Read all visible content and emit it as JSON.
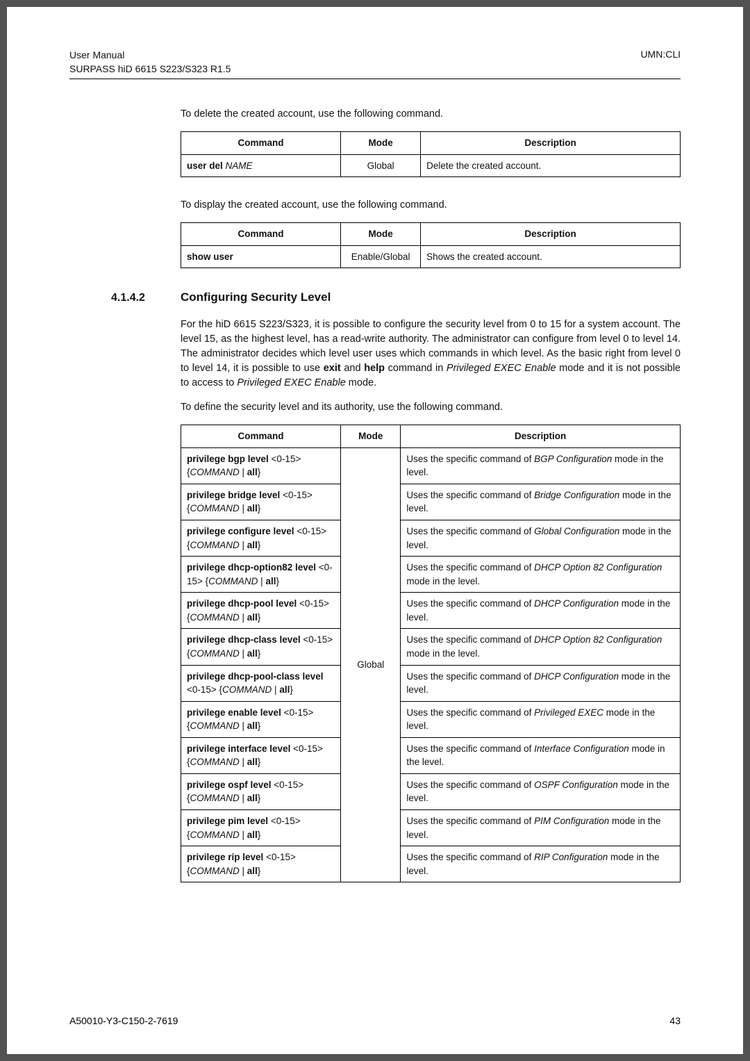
{
  "header": {
    "left1": "User Manual",
    "left2": "SURPASS hiD 6615 S223/S323 R1.5",
    "right": "UMN:CLI"
  },
  "intro1": "To delete the created account, use the following command.",
  "table1": {
    "h1": "Command",
    "h2": "Mode",
    "h3": "Description",
    "r1c1a": "user del ",
    "r1c1b": "NAME",
    "r1c2": "Global",
    "r1c3": "Delete the created account."
  },
  "intro2": "To display the created account, use the following command.",
  "table2": {
    "h1": "Command",
    "h2": "Mode",
    "h3": "Description",
    "r1c1": "show user",
    "r1c2": "Enable/Global",
    "r1c3": "Shows the created account."
  },
  "section": {
    "num": "4.1.4.2",
    "title": "Configuring Security Level"
  },
  "para1a": "For the hiD 6615 S223/S323, it is possible to configure the security level from 0 to 15 for a system account. The level 15, as the highest level, has a read-write authority. The administrator can configure from level 0 to level 14. The administrator decides which level user uses which commands in which level. As the basic right from level 0 to level 14, it is possible to use ",
  "para1b": "exit",
  "para1c": " and ",
  "para1d": "help",
  "para1e": " command in ",
  "para1f": "Privileged EXEC Enable",
  "para1g": " mode and it is not possible to access to ",
  "para1h": "Privileged EXEC Enable",
  "para1i": " mode.",
  "intro3": "To define the security level and its authority, use the following command.",
  "table3": {
    "h1": "Command",
    "h2": "Mode",
    "h3": "Description",
    "mode": "Global",
    "rows": [
      {
        "c1a": "privilege bgp level ",
        "c1b": "<0-15> {",
        "c1c": "COMMAND",
        "c1d": " | ",
        "c1e": "all",
        "c1f": "}",
        "d1": "Uses the specific command of ",
        "d2": "BGP Configuration",
        "d3": " mode in the level."
      },
      {
        "c1a": "privilege bridge level ",
        "c1b": "<0-15> {",
        "c1c": "COMMAND",
        "c1d": " | ",
        "c1e": "all",
        "c1f": "}",
        "d1": "Uses the specific command of ",
        "d2": "Bridge Configuration",
        "d3": " mode in the level."
      },
      {
        "c1a": "privilege configure level ",
        "c1b": "<0-15> {",
        "c1c": "COMMAND",
        "c1d": " | ",
        "c1e": "all",
        "c1f": "}",
        "d1": "Uses the specific command of ",
        "d2": "Global Configuration",
        "d3": " mode in the level."
      },
      {
        "c1a": "privilege dhcp-option82 level ",
        "c1b": "<0-15> {",
        "c1c": "COMMAND",
        "c1d": " | ",
        "c1e": "all",
        "c1f": "}",
        "d1": "Uses the specific command of ",
        "d2": "DHCP Option 82 Configuration",
        "d3": " mode in the level."
      },
      {
        "c1a": "privilege dhcp-pool level ",
        "c1b": "<0-15> {",
        "c1c": "COMMAND",
        "c1d": " | ",
        "c1e": "all",
        "c1f": "}",
        "d1": "Uses the specific command of ",
        "d2": "DHCP Configuration",
        "d3": " mode in the level."
      },
      {
        "c1a": "privilege dhcp-class level ",
        "c1b": "<0-15> {",
        "c1c": "COMMAND",
        "c1d": " | ",
        "c1e": "all",
        "c1f": "}",
        "d1": "Uses the specific command of ",
        "d2": "DHCP Option 82 Configuration",
        "d3": " mode in the level."
      },
      {
        "c1a": "privilege dhcp-pool-class level ",
        "c1b": "<0-15> {",
        "c1c": "COMMAND",
        "c1d": " | ",
        "c1e": "all",
        "c1f": "}",
        "d1": "Uses the specific command of ",
        "d2": "DHCP Configuration",
        "d3": " mode in the level."
      },
      {
        "c1a": "privilege enable level ",
        "c1b": "<0-15> {",
        "c1c": "COMMAND",
        "c1d": " | ",
        "c1e": "all",
        "c1f": "}",
        "d1": "Uses the specific command of ",
        "d2": "Privileged EXEC",
        "d3": " mode in the level."
      },
      {
        "c1a": "privilege interface level ",
        "c1b": "<0-15> {",
        "c1c": "COMMAND",
        "c1d": " | ",
        "c1e": "all",
        "c1f": "}",
        "d1": "Uses the specific command of ",
        "d2": "Interface Configuration",
        "d3": " mode in the level."
      },
      {
        "c1a": "privilege ospf level ",
        "c1b": "<0-15> {",
        "c1c": "COMMAND",
        "c1d": " | ",
        "c1e": "all",
        "c1f": "}",
        "d1": "Uses the specific command of ",
        "d2": "OSPF Configuration",
        "d3": " mode in the level."
      },
      {
        "c1a": "privilege pim level ",
        "c1b": "<0-15> {",
        "c1c": "COMMAND",
        "c1d": " | ",
        "c1e": "all",
        "c1f": "}",
        "d1": "Uses the specific command of ",
        "d2": "PIM Configuration",
        "d3": " mode in the level."
      },
      {
        "c1a": "privilege rip level ",
        "c1b": "<0-15> {",
        "c1c": "COMMAND",
        "c1d": " | ",
        "c1e": "all",
        "c1f": "}",
        "d1": "Uses the specific command of ",
        "d2": "RIP Configuration",
        "d3": " mode in the level."
      }
    ]
  },
  "footer": {
    "left": "A50010-Y3-C150-2-7619",
    "right": "43"
  }
}
